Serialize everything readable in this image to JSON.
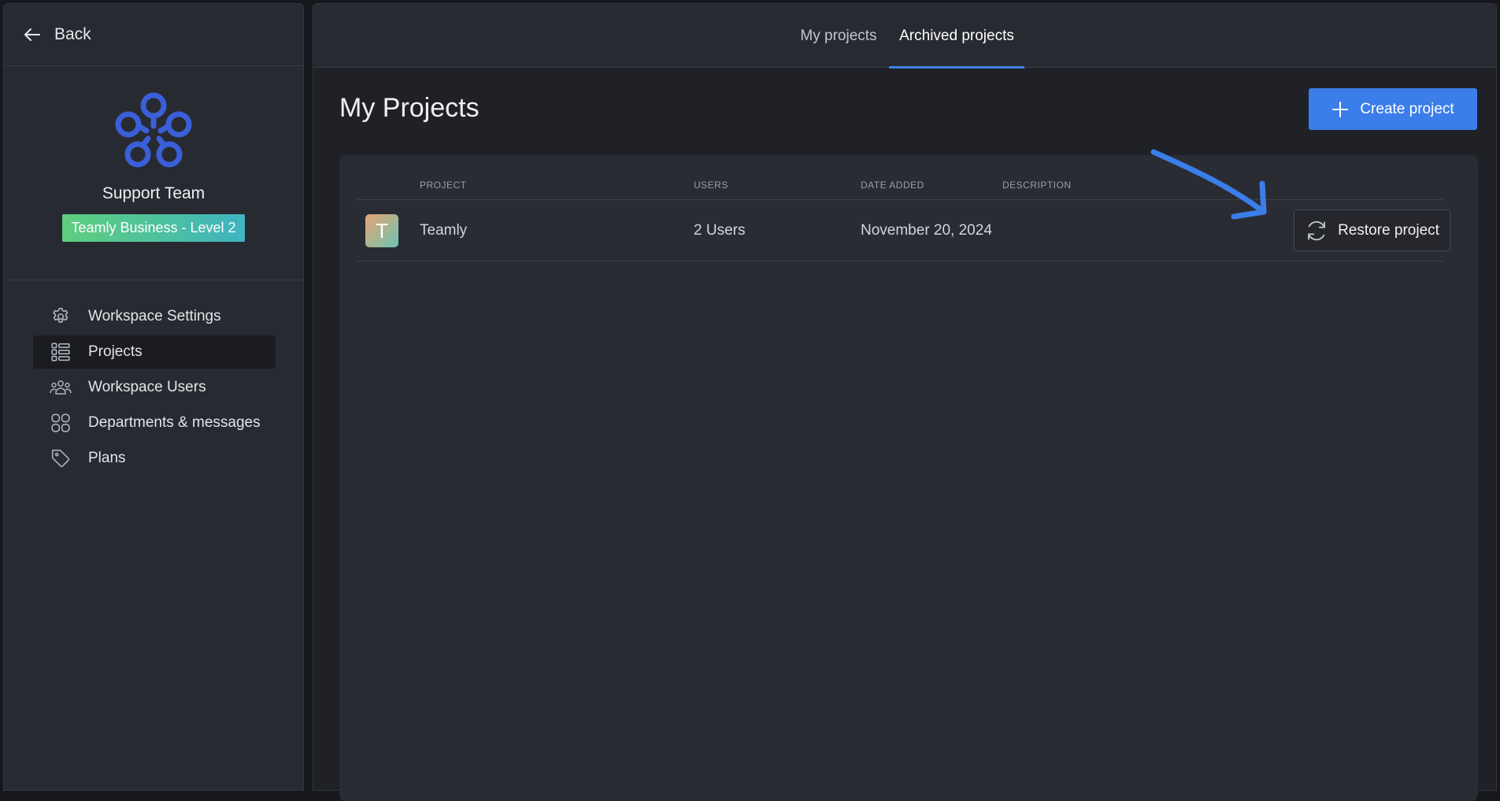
{
  "sidebar": {
    "back_label": "Back",
    "team_name": "Support Team",
    "plan_badge": "Teamly Business - Level 2",
    "items": [
      {
        "label": "Workspace Settings",
        "icon": "gear-icon"
      },
      {
        "label": "Projects",
        "icon": "list-icon",
        "active": true
      },
      {
        "label": "Workspace Users",
        "icon": "users-icon"
      },
      {
        "label": "Departments & messages",
        "icon": "grid-icon"
      },
      {
        "label": "Plans",
        "icon": "tag-icon"
      }
    ]
  },
  "tabs": [
    {
      "label": "My projects",
      "active": false
    },
    {
      "label": "Archived projects",
      "active": true
    }
  ],
  "main": {
    "title": "My Projects",
    "create_button": "Create project"
  },
  "table": {
    "columns": [
      "PROJECT",
      "USERS",
      "DATE ADDED",
      "DESCRIPTION"
    ],
    "rows": [
      {
        "avatar_letter": "T",
        "project": "Teamly",
        "users": "2 Users",
        "date_added": "November 20, 2024",
        "description": "",
        "action": "Restore project"
      }
    ]
  },
  "colors": {
    "accent": "#3b7de9",
    "logo": "#3b5fd9",
    "annotation": "#3b7de9"
  }
}
